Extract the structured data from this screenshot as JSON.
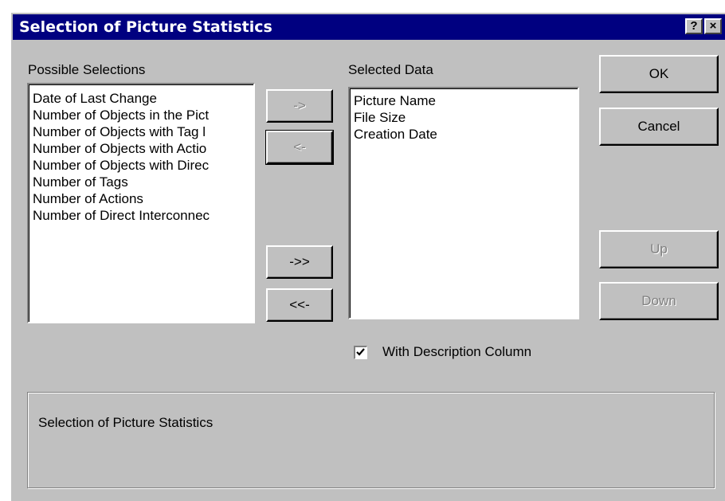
{
  "window": {
    "title": "Selection of Picture Statistics",
    "help_button": "?",
    "close_button": "×"
  },
  "possible": {
    "label": "Possible Selections",
    "items": [
      "Date of Last Change",
      "Number of Objects in the Pict",
      "Number of Objects with Tag l",
      "Number of Objects with Actio",
      "Number of Objects with Direc",
      "Number of Tags",
      "Number of Actions",
      "Number of Direct Interconnec"
    ]
  },
  "selected": {
    "label": "Selected Data",
    "items": [
      "Picture Name",
      "File Size",
      "Creation Date"
    ]
  },
  "transfer": {
    "add": "->",
    "remove": "<-",
    "add_all": "->>",
    "remove_all": "<<-"
  },
  "buttons": {
    "ok": "OK",
    "cancel": "Cancel",
    "up": "Up",
    "down": "Down"
  },
  "description_option": {
    "label": "With Description Column",
    "checked": true
  },
  "description": {
    "text": "Selection of Picture Statistics"
  },
  "colors": {
    "titlebar": "#000080",
    "face": "#c0c0c0"
  }
}
